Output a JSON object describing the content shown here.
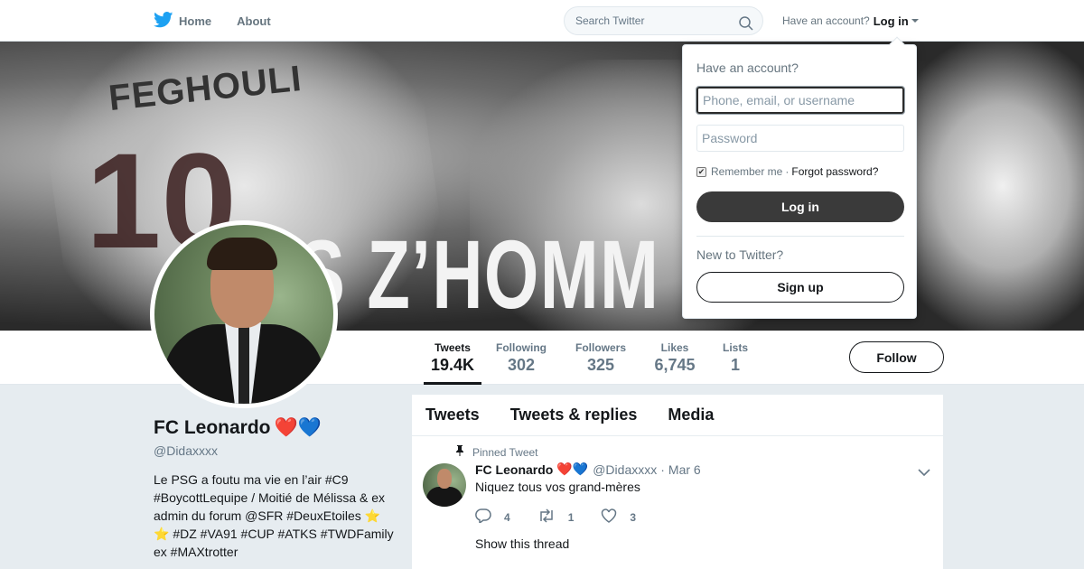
{
  "nav": {
    "home_label": "Home",
    "about_label": "About",
    "search_placeholder": "Search Twitter",
    "have_account": "Have an account?",
    "login_label": "Log in",
    "brand_color": "#1da1f2"
  },
  "banner": {
    "jersey_name": "FEGHOULI",
    "jersey_number": "10",
    "slogan": "S Z’HOMM"
  },
  "profile": {
    "name": "FC Leonardo",
    "name_emojis": "❤️💙",
    "handle": "@Didaxxxx",
    "bio": "Le PSG a foutu ma vie en l’air #C9 #BoycottLequipe / Moitié de Mélissa & ex admin du forum @SFR #DeuxEtoiles ⭐ ⭐ #DZ #VA91 #CUP #ATKS #TWDFamily ex #MAXtrotter"
  },
  "stats": [
    {
      "label": "Tweets",
      "value": "19.4K",
      "active": true
    },
    {
      "label": "Following",
      "value": "302",
      "active": false
    },
    {
      "label": "Followers",
      "value": "325",
      "active": false
    },
    {
      "label": "Likes",
      "value": "6,745",
      "active": false
    },
    {
      "label": "Lists",
      "value": "1",
      "active": false
    }
  ],
  "follow_label": "Follow",
  "timeline": {
    "tabs": [
      "Tweets",
      "Tweets & replies",
      "Media"
    ],
    "tweet": {
      "pinned_label": "Pinned Tweet",
      "author": "FC Leonardo",
      "author_emojis": "❤️💙",
      "handle": "@Didaxxxx",
      "separator": "·",
      "date": "Mar 6",
      "text": "Niquez tous vos grand-mères",
      "replies": "4",
      "retweets": "1",
      "likes": "3",
      "thread_label": "Show this thread"
    }
  },
  "login_dropdown": {
    "title": "Have an account?",
    "username_placeholder": "Phone, email, or username",
    "password_placeholder": "Password",
    "remember_label": "Remember me",
    "separator": "·",
    "forgot_label": "Forgot password?",
    "login_button": "Log in",
    "new_label": "New to Twitter?",
    "signup_button": "Sign up"
  }
}
